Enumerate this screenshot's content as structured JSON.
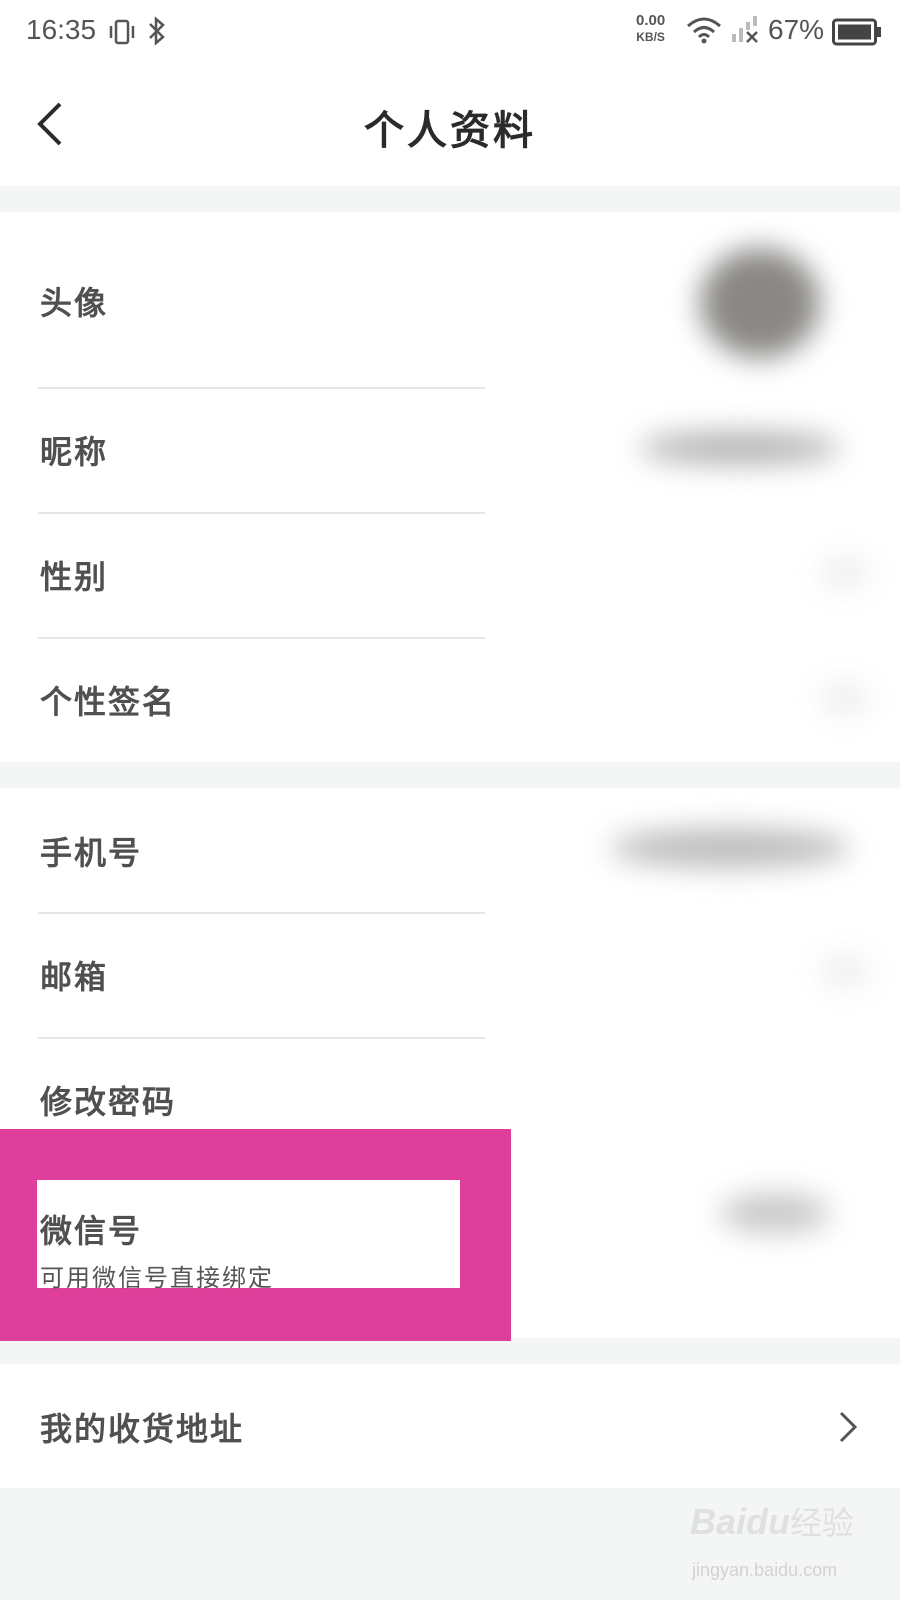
{
  "status_bar": {
    "time": "16:35",
    "net_speed_value": "0.00",
    "net_speed_unit": "KB/S",
    "battery_percent": "67%",
    "icons": [
      "vibrate-icon",
      "bluetooth-icon",
      "wifi-icon",
      "signal-icon",
      "battery-icon"
    ]
  },
  "header": {
    "title": "个人资料",
    "back_icon": "back-chevron-icon"
  },
  "profile_group": {
    "avatar_label": "头像",
    "nickname_label": "昵称",
    "gender_label": "性别",
    "signature_label": "个性签名"
  },
  "account_group": {
    "phone_label": "手机号",
    "email_label": "邮箱",
    "change_password_label": "修改密码",
    "wechat_label": "微信号",
    "wechat_hint": "可用微信号直接绑定"
  },
  "address_group": {
    "address_label": "我的收货地址",
    "chevron_icon": "chevron-right-icon"
  },
  "watermark": {
    "brand": "Baidu",
    "brand_cn": "经验",
    "url": "jingyan.baidu.com"
  },
  "colors": {
    "highlight": "#dd3f9a",
    "background": "#f4f5f5",
    "surface": "#ffffff"
  }
}
